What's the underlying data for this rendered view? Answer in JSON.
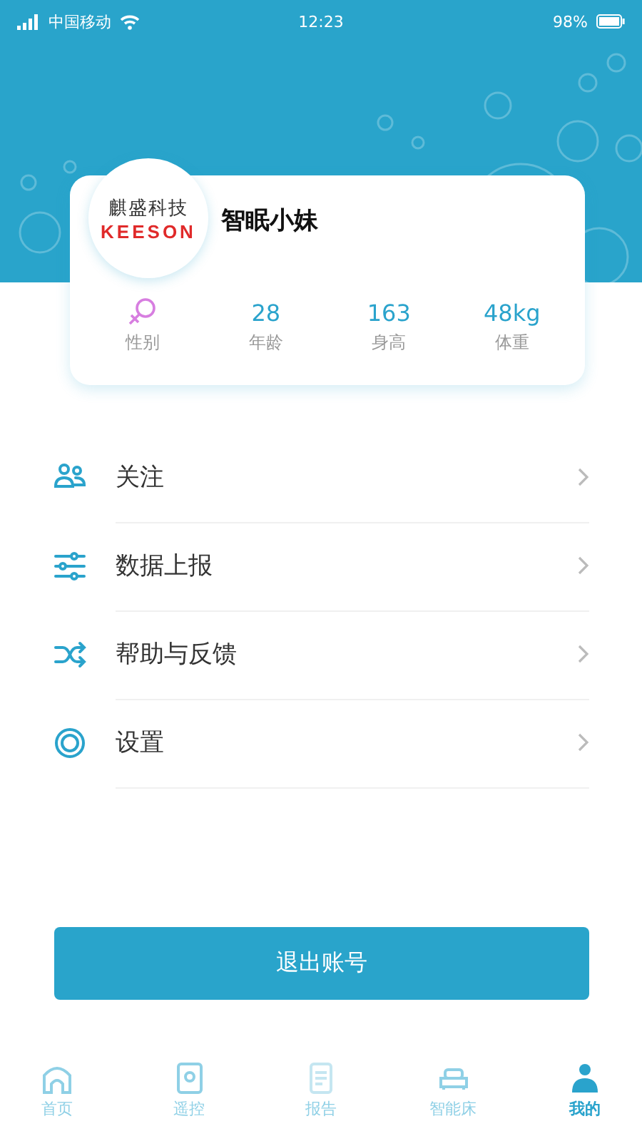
{
  "status_bar": {
    "carrier": "中国移动",
    "time": "12:23",
    "battery": "98%"
  },
  "profile": {
    "logo_top": "麒盛科技",
    "logo_bottom": "KEESON",
    "name": "智眠小妹",
    "stats": [
      {
        "kind": "female",
        "label": "性别"
      },
      {
        "kind": "value",
        "value": "28",
        "label": "年龄"
      },
      {
        "kind": "value",
        "value": "163",
        "label": "身高"
      },
      {
        "kind": "value",
        "value": "48kg",
        "label": "体重"
      }
    ]
  },
  "menu": [
    {
      "kind": "people",
      "label": "关注"
    },
    {
      "kind": "sliders",
      "label": "数据上报"
    },
    {
      "kind": "shuffle",
      "label": "帮助与反馈"
    },
    {
      "kind": "gear",
      "label": "设置"
    }
  ],
  "logout_button": "退出账号",
  "tabs": [
    {
      "kind": "home",
      "label": "首页",
      "selected": false
    },
    {
      "kind": "remote",
      "label": "遥控",
      "selected": false
    },
    {
      "kind": "report",
      "label": "报告",
      "selected": false
    },
    {
      "kind": "bed",
      "label": "智能床",
      "selected": false
    },
    {
      "kind": "user",
      "label": "我的",
      "selected": true
    }
  ]
}
